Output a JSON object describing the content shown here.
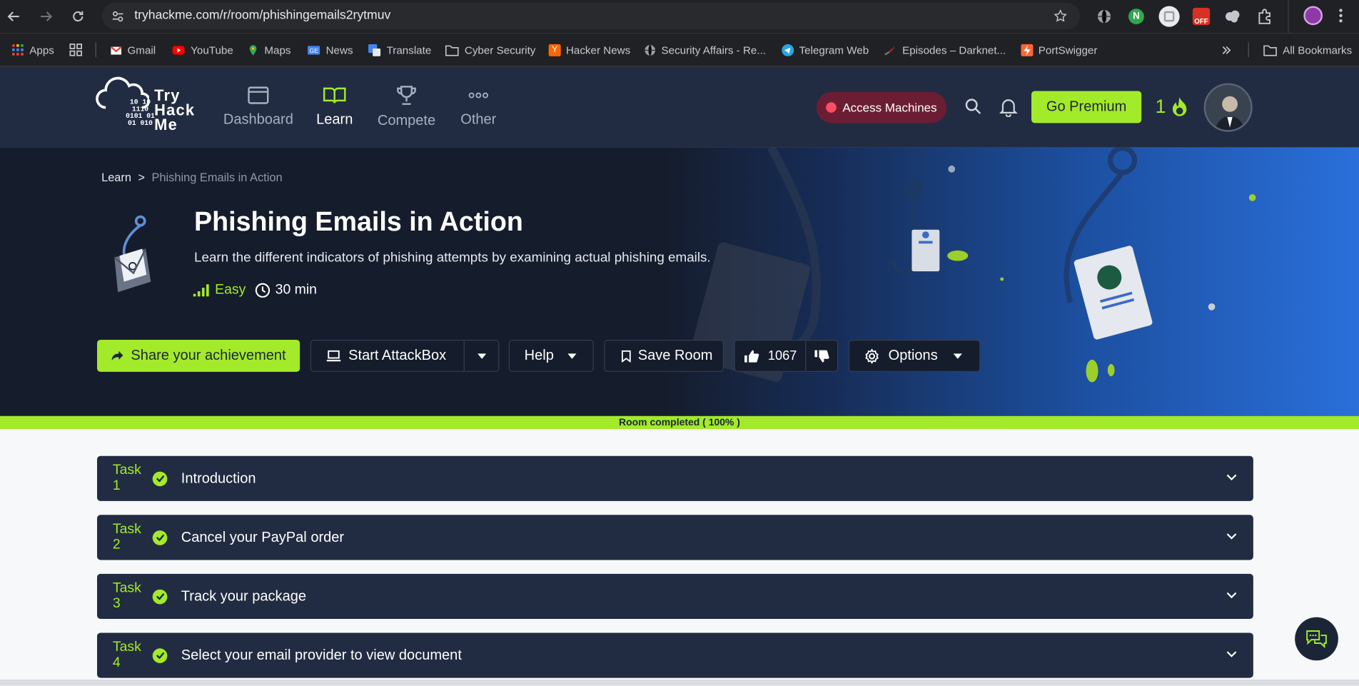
{
  "browser": {
    "url": "tryhackme.com/r/room/phishingemails2rytmuv",
    "bookmarks": [
      "Apps",
      "Gmail",
      "YouTube",
      "Maps",
      "News",
      "Translate",
      "Cyber Security",
      "Hacker News",
      "Security Affairs - Re...",
      "Telegram Web",
      "Episodes – Darknet...",
      "PortSwigger"
    ],
    "all_bookmarks": "All Bookmarks",
    "ext_badge": "OFF"
  },
  "header": {
    "logo": [
      "Try",
      "Hack",
      "Me"
    ],
    "nav": [
      "Dashboard",
      "Learn",
      "Compete",
      "Other"
    ],
    "access_machines": "Access Machines",
    "go_premium": "Go Premium",
    "streak": "1"
  },
  "room": {
    "breadcrumb_root": "Learn",
    "breadcrumb_sep": ">",
    "breadcrumb_current": "Phishing Emails in Action",
    "title": "Phishing Emails in Action",
    "description": "Learn the different indicators of phishing attempts by examining actual phishing emails.",
    "difficulty": "Easy",
    "duration": "30 min",
    "share_label": "Share your achievement",
    "attackbox_label": "Start AttackBox",
    "help_label": "Help",
    "save_label": "Save Room",
    "likes": "1067",
    "options_label": "Options",
    "progress_text": "Room completed ( 100% )",
    "progress_fraction": 1.0
  },
  "tasks": [
    {
      "num": "Task 1",
      "title": "Introduction"
    },
    {
      "num": "Task 2",
      "title": "Cancel your PayPal order"
    },
    {
      "num": "Task 3",
      "title": "Track your package"
    },
    {
      "num": "Task 4",
      "title": "Select your email provider to view document"
    }
  ],
  "colors": {
    "accent": "#a3ea2a",
    "header": "#212c42",
    "hero": "#151c2b",
    "access": "#6b1d34"
  }
}
